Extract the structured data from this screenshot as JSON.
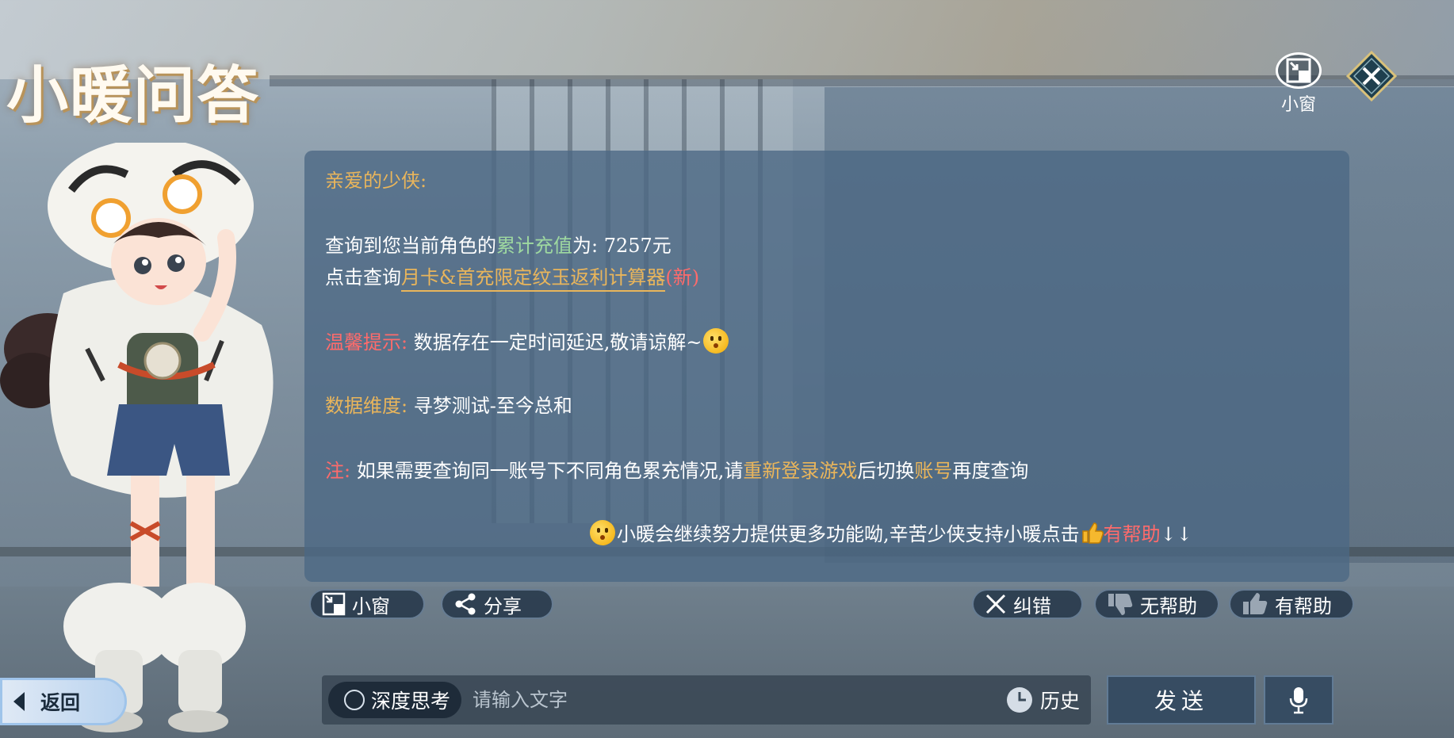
{
  "header": {
    "title": "小暖问答",
    "mini_window_label": "小窗"
  },
  "message": {
    "greeting": "亲爱的少侠:",
    "recharge_prefix": "查询到您当前角色的",
    "recharge_highlight": "累计充值",
    "recharge_suffix": "为: 7257元",
    "calc_prefix": "点击查询",
    "calc_link": "月卡&首充限定纹玉返利计算器",
    "calc_new": "(新)",
    "tip_label": "温馨提示:",
    "tip_text": "数据存在一定时间延迟,敬请谅解~",
    "dimension_label": "数据维度:",
    "dimension_text": "寻梦测试-至今总和",
    "note_label": "注:",
    "note_text_1": "如果需要查询同一账号下不同角色累充情况,请",
    "note_relogin": "重新登录游戏",
    "note_text_2": "后切换",
    "note_account": "账号",
    "note_text_3": "再度查询",
    "footer_text": "小暖会继续努力提供更多功能呦,辛苦少侠支持小暖点击",
    "footer_helpful": "有帮助",
    "footer_arrows": "↓↓"
  },
  "actions": {
    "mini_window": "小窗",
    "share": "分享",
    "correct": "纠错",
    "not_helpful": "无帮助",
    "helpful": "有帮助"
  },
  "bottom": {
    "back": "返回",
    "deep_think": "深度思考",
    "input_placeholder": "请输入文字",
    "input_value": "",
    "history": "历史",
    "send": "发送"
  },
  "colors": {
    "gold": "#e9b55b",
    "green": "#9ed8a0",
    "red": "#ff6b6b",
    "panel": "#4c6884"
  },
  "icons": [
    "mini-window-icon",
    "close-icon",
    "share-icon",
    "close-x-icon",
    "thumbs-down-icon",
    "thumbs-up-icon",
    "back-arrow-icon",
    "clock-icon",
    "microphone-icon",
    "emoji-icon"
  ]
}
